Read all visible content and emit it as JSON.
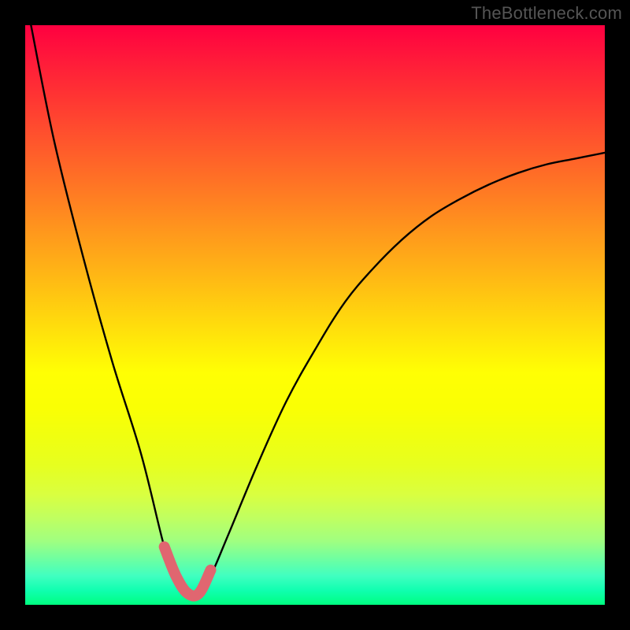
{
  "watermark": "TheBottleneck.com",
  "chart_data": {
    "type": "line",
    "title": "",
    "xlabel": "",
    "ylabel": "",
    "xlim": [
      0,
      100
    ],
    "ylim": [
      0,
      100
    ],
    "grid": false,
    "series": [
      {
        "name": "main-curve",
        "color": "#000000",
        "x": [
          1,
          5,
          10,
          15,
          20,
          24,
          26,
          28,
          30,
          32,
          35,
          40,
          45,
          50,
          55,
          60,
          65,
          70,
          75,
          80,
          85,
          90,
          95,
          100
        ],
        "y": [
          100,
          80,
          60,
          42,
          26,
          10,
          5,
          2,
          2,
          5,
          12,
          24,
          35,
          44,
          52,
          58,
          63,
          67,
          70,
          72.5,
          74.5,
          76,
          77,
          78
        ]
      },
      {
        "name": "highlight-segment",
        "color": "#e06670",
        "x": [
          24,
          26,
          28,
          30,
          32
        ],
        "y": [
          10,
          5,
          2,
          2,
          6
        ]
      }
    ],
    "annotations": []
  }
}
